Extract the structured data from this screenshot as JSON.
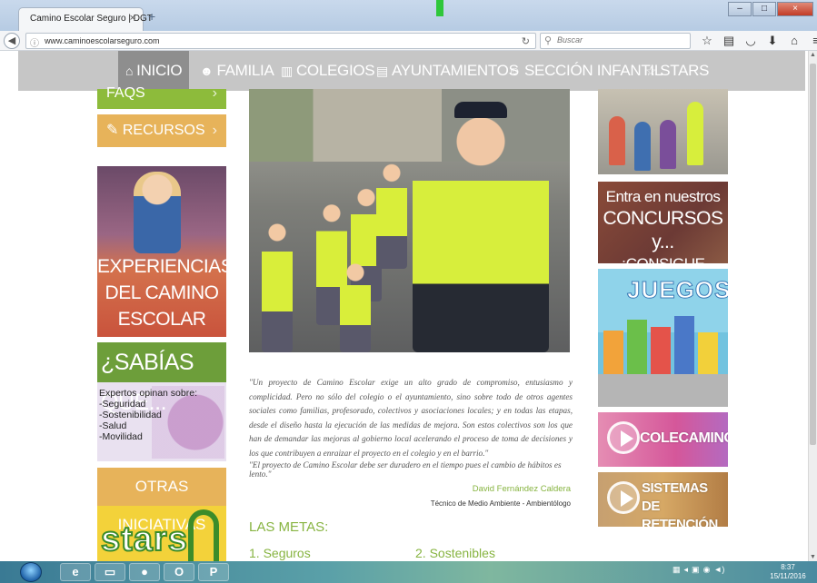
{
  "browser": {
    "tab_title": "Camino Escolar Seguro | DGT",
    "tab_close": "×",
    "new_tab": "+",
    "url": "www.caminoescolarseguro.com",
    "search_placeholder": "Buscar",
    "window_controls": [
      "–",
      "□",
      "×"
    ]
  },
  "site_nav": {
    "items": [
      {
        "icon": "⌂",
        "label": "INICIO"
      },
      {
        "icon": "☻",
        "label": "FAMILIA"
      },
      {
        "icon": "▥",
        "label": "COLEGIOS"
      },
      {
        "icon": "▤",
        "label": "AYUNTAMIENTOS"
      },
      {
        "icon": "☺",
        "label": "SECCIÓN INFANTIL"
      },
      {
        "icon": "☆",
        "label": "STARS"
      }
    ]
  },
  "left": {
    "faqs": "FAQS",
    "recursos": "RECURSOS",
    "experiencias": [
      "EXPERIENCIAS",
      "DEL CAMINO",
      "ESCOLAR SEGURO"
    ],
    "sabias_title": "¿SABÍAS QUE...",
    "sabias_lines": [
      "Expertos opinan sobre:",
      "-Seguridad",
      "-Sostenibilidad",
      "-Salud",
      "-Movilidad"
    ],
    "otras": "OTRAS INICIATIVAS",
    "stars_logo": "stars"
  },
  "main": {
    "quote1": "\"Un proyecto de Camino Escolar exige un alto grado de compromiso, entusiasmo y complicidad. Pero no sólo del colegio o el ayuntamiento, sino sobre todo de otros agentes sociales como familias, profesorado, colectivos y asociaciones locales; y en todas las etapas, desde el diseño hasta la ejecución de las medidas de mejora. Son estos colectivos son los que han de demandar las mejoras al gobierno local acelerando el proceso de toma de decisiones y los que contribuyen a enraizar el proyecto en el colegio y en el barrio.\"",
    "quote2": "\"El proyecto de Camino Escolar debe ser duradero en el tiempo pues el cambio de hábitos es lento.\"",
    "author": "David Fernández Caldera",
    "author_role": "Técnico de Medio Ambiente - Ambientólogo",
    "metas_title": "LAS METAS:",
    "metas": [
      "1. Seguros",
      "2. Sostenibles"
    ]
  },
  "right": {
    "concursos": [
      "Entra en nuestros",
      "CONCURSOS y...",
      "¡CONSIGUE PREMIOS!"
    ],
    "juegos": "JUEGOS",
    "colecaminos": "COLECAMINOS",
    "sistemas": [
      "SISTEMAS DE",
      "RETENCIÓN INF."
    ]
  },
  "taskbar": {
    "apps": [
      "e",
      "▭",
      "●",
      "O",
      "P"
    ],
    "time": "8:37",
    "date": "15/11/2016"
  }
}
